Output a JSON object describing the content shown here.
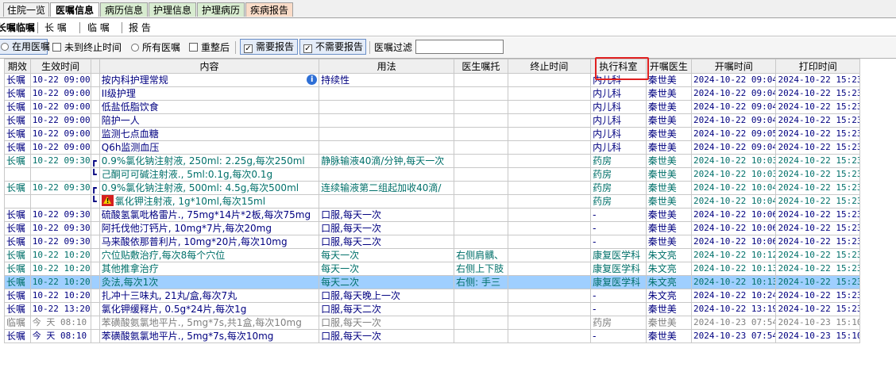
{
  "top_tabs": [
    {
      "label": "住院一览",
      "active": false,
      "bg": "#f0f0f0"
    },
    {
      "label": "医嘱信息",
      "active": true,
      "bg": "#ffffff"
    },
    {
      "label": "病历信息",
      "active": false,
      "bg": "#d8ecd0"
    },
    {
      "label": "护理信息",
      "active": false,
      "bg": "#d8ecd0"
    },
    {
      "label": "护理病历",
      "active": false,
      "bg": "#d8ecd0"
    },
    {
      "label": "疾病报告",
      "active": false,
      "bg": "#fadcc8"
    }
  ],
  "sub_tabs": [
    {
      "label": "长嘱临嘱"
    },
    {
      "label": "长 嘱"
    },
    {
      "label": "临 嘱"
    },
    {
      "label": "报 告"
    }
  ],
  "filters": {
    "in_use": "在用医嘱",
    "not_ended": "未到终止时间",
    "all_orders": "所有医嘱",
    "after_reorg": "重整后",
    "need_report": "需要报告",
    "no_report": "不需要报告",
    "filter_label": "医嘱过滤",
    "filter_value": ""
  },
  "columns": [
    "期效",
    "生效时间",
    "",
    "内容",
    "用法",
    "医生嘱托",
    "终止时间",
    "执行科室",
    "开嘱医生",
    "开嘱时间",
    "打印时间"
  ],
  "rows": [
    {
      "period": "长嘱",
      "start": "10-22 09:00",
      "bracket": "",
      "content": "按内科护理常规",
      "usage": "持续性",
      "note": "",
      "end": "",
      "dept": "内儿科",
      "doctor": "秦世美",
      "order_time": "2024-10-22 09:04",
      "print_time": "2024-10-22 15:23",
      "style": "",
      "info": true
    },
    {
      "period": "长嘱",
      "start": "10-22 09:00",
      "bracket": "",
      "content": "II级护理",
      "usage": "",
      "note": "",
      "end": "",
      "dept": "内儿科",
      "doctor": "秦世美",
      "order_time": "2024-10-22 09:04",
      "print_time": "2024-10-22 15:23",
      "style": ""
    },
    {
      "period": "长嘱",
      "start": "10-22 09:00",
      "bracket": "",
      "content": "低盐低脂饮食",
      "usage": "",
      "note": "",
      "end": "",
      "dept": "内儿科",
      "doctor": "秦世美",
      "order_time": "2024-10-22 09:04",
      "print_time": "2024-10-22 15:23",
      "style": ""
    },
    {
      "period": "长嘱",
      "start": "10-22 09:00",
      "bracket": "",
      "content": "陪护一人",
      "usage": "",
      "note": "",
      "end": "",
      "dept": "内儿科",
      "doctor": "秦世美",
      "order_time": "2024-10-22 09:04",
      "print_time": "2024-10-22 15:23",
      "style": ""
    },
    {
      "period": "长嘱",
      "start": "10-22 09:00",
      "bracket": "",
      "content": "监测七点血糖",
      "usage": "",
      "note": "",
      "end": "",
      "dept": "内儿科",
      "doctor": "秦世美",
      "order_time": "2024-10-22 09:05",
      "print_time": "2024-10-22 15:23",
      "style": ""
    },
    {
      "period": "长嘱",
      "start": "10-22 09:00",
      "bracket": "",
      "content": "Q6h监测血压",
      "usage": "",
      "note": "",
      "end": "",
      "dept": "内儿科",
      "doctor": "秦世美",
      "order_time": "2024-10-22 09:04",
      "print_time": "2024-10-22 15:23",
      "style": ""
    },
    {
      "period": "长嘱",
      "start": "10-22 09:30",
      "bracket": "┏",
      "content": "0.9%氯化钠注射液, 250ml: 2.25g,每次250ml",
      "usage": "静脉输液40滴/分钟,每天一次",
      "note": "",
      "end": "",
      "dept": "药房",
      "doctor": "秦世美",
      "order_time": "2024-10-22 10:03",
      "print_time": "2024-10-22 15:23",
      "style": "teal"
    },
    {
      "period": "",
      "start": "",
      "bracket": "┗",
      "content": "己酮可可碱注射液., 5ml:0.1g,每次0.1g",
      "usage": "",
      "note": "",
      "end": "",
      "dept": "药房",
      "doctor": "秦世美",
      "order_time": "2024-10-22 10:03",
      "print_time": "2024-10-22 15:23",
      "style": "teal"
    },
    {
      "period": "长嘱",
      "start": "10-22 09:30",
      "bracket": "┏",
      "content": "0.9%氯化钠注射液, 500ml: 4.5g,每次500ml",
      "usage": "连续输液第二组起加收40滴/",
      "note": "",
      "end": "",
      "dept": "药房",
      "doctor": "秦世美",
      "order_time": "2024-10-22 10:04",
      "print_time": "2024-10-22 15:23",
      "style": "teal"
    },
    {
      "period": "",
      "start": "",
      "bracket": "┗",
      "content": "氯化钾注射液, 1g*10ml,每次15ml",
      "usage": "",
      "note": "",
      "end": "",
      "dept": "药房",
      "doctor": "秦世美",
      "order_time": "2024-10-22 10:04",
      "print_time": "2024-10-22 15:23",
      "style": "teal",
      "warn": true
    },
    {
      "period": "长嘱",
      "start": "10-22 09:30",
      "bracket": "",
      "content": "硫酸氢氯吡格雷片., 75mg*14片*2板,每次75mg",
      "usage": "口服,每天一次",
      "note": "",
      "end": "",
      "dept": "-",
      "doctor": "秦世美",
      "order_time": "2024-10-22 10:06",
      "print_time": "2024-10-22 15:23",
      "style": ""
    },
    {
      "period": "长嘱",
      "start": "10-22 09:30",
      "bracket": "",
      "content": "阿托伐他汀钙片, 10mg*7片,每次20mg",
      "usage": "口服,每天一次",
      "note": "",
      "end": "",
      "dept": "-",
      "doctor": "秦世美",
      "order_time": "2024-10-22 10:06",
      "print_time": "2024-10-22 15:23",
      "style": ""
    },
    {
      "period": "长嘱",
      "start": "10-22 09:30",
      "bracket": "",
      "content": "马来酸依那普利片, 10mg*20片,每次10mg",
      "usage": "口服,每天二次",
      "note": "",
      "end": "",
      "dept": "-",
      "doctor": "秦世美",
      "order_time": "2024-10-22 10:06",
      "print_time": "2024-10-22 15:23",
      "style": ""
    },
    {
      "period": "长嘱",
      "start": "10-22 10:20",
      "bracket": "",
      "content": "穴位贴敷治疗,每次8每个穴位",
      "usage": "每天一次",
      "note": "右侧肩髃、",
      "end": "",
      "dept": "康复医学科",
      "doctor": "朱文亮",
      "order_time": "2024-10-22 10:12",
      "print_time": "2024-10-22 15:23",
      "style": "teal"
    },
    {
      "period": "长嘱",
      "start": "10-22 10:20",
      "bracket": "",
      "content": "其他推拿治疗",
      "usage": "每天一次",
      "note": "右侧上下肢",
      "end": "",
      "dept": "康复医学科",
      "doctor": "朱文亮",
      "order_time": "2024-10-22 10:13",
      "print_time": "2024-10-22 15:23",
      "style": "teal"
    },
    {
      "period": "长嘱",
      "start": "10-22 10:20",
      "bracket": "",
      "content": "灸法,每次1次",
      "usage": "每天二次",
      "note": "右侧: 手三",
      "end": "",
      "dept": "康复医学科",
      "doctor": "朱文亮",
      "order_time": "2024-10-22 10:13",
      "print_time": "2024-10-22 15:23",
      "style": "sel"
    },
    {
      "period": "长嘱",
      "start": "10-22 10:20",
      "bracket": "",
      "content": "扎冲十三味丸, 21丸/盒,每次7丸",
      "usage": "口服,每天晚上一次",
      "note": "",
      "end": "",
      "dept": "-",
      "doctor": "朱文亮",
      "order_time": "2024-10-22 10:24",
      "print_time": "2024-10-22 15:23",
      "style": ""
    },
    {
      "period": "长嘱",
      "start": "10-22 13:20",
      "bracket": "",
      "content": "氯化钾缓释片, 0.5g*24片,每次1g",
      "usage": "口服,每天二次",
      "note": "",
      "end": "",
      "dept": "-",
      "doctor": "秦世美",
      "order_time": "2024-10-22 13:19",
      "print_time": "2024-10-22 15:23",
      "style": ""
    },
    {
      "period": "临嘱",
      "start": "今 天 08:10",
      "bracket": "",
      "content": "苯磺酸氨氯地平片., 5mg*7s,共1盒,每次10mg",
      "usage": "口服,每天一次",
      "note": "",
      "end": "",
      "dept": "药房",
      "doctor": "秦世美",
      "order_time": "2024-10-23 07:54",
      "print_time": "2024-10-23 15:10",
      "style": "grey"
    },
    {
      "period": "长嘱",
      "start": "今 天 08:10",
      "bracket": "",
      "content": "苯磺酸氨氯地平片., 5mg*7s,每次10mg",
      "usage": "口服,每天一次",
      "note": "",
      "end": "",
      "dept": "-",
      "doctor": "秦世美",
      "order_time": "2024-10-23 07:54",
      "print_time": "2024-10-23 15:10",
      "style": ""
    }
  ]
}
